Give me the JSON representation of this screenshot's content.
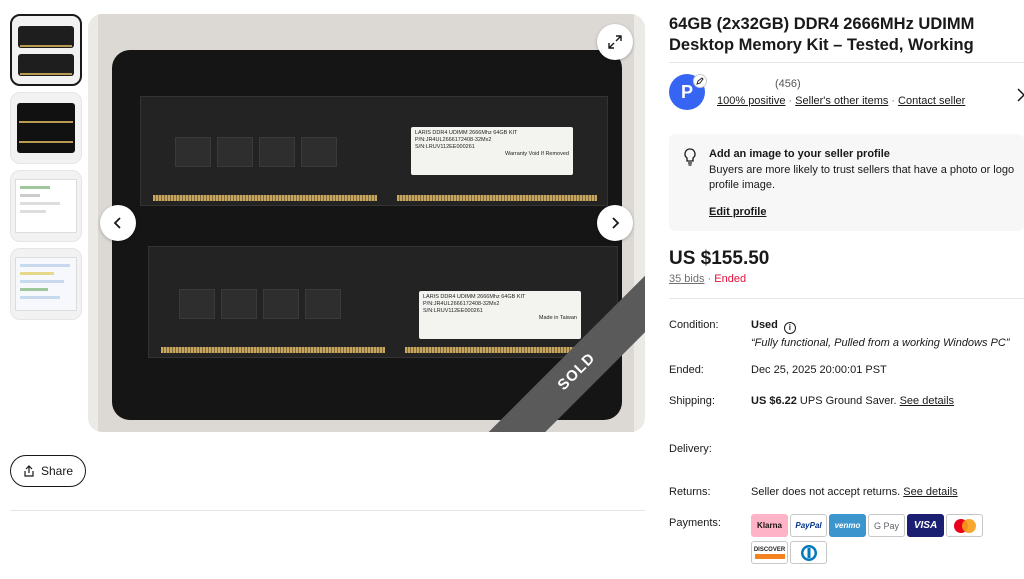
{
  "listing": {
    "title": "64GB (2x32GB) DDR4 2666MHz UDIMM Desktop Memory Kit – Tested, Working"
  },
  "gallery": {
    "sold_badge": "SOLD",
    "ram_label_line1": "LARIS DDR4 UDIMM 2666Mhz 64GB KIT",
    "ram_label_line2": "P/N:JR4UL2666172408-32Mx2",
    "ram_label_line3": "S/N:LRUV112EE000261",
    "ram_label_made": "Made in Taiwan",
    "ram_label_warranty": "Warranty Void If Removed",
    "ram_brand": "LEVEN"
  },
  "share": {
    "label": "Share"
  },
  "seller": {
    "avatar_letter": "P",
    "feedback_count": "(456)",
    "positive": "100% positive",
    "other_items": "Seller's other items",
    "contact": "Contact seller"
  },
  "profile_prompt": {
    "title": "Add an image to your seller profile",
    "text": "Buyers are more likely to trust sellers that have a photo or logo profile image.",
    "link": "Edit profile"
  },
  "price": {
    "amount": "US $155.50",
    "bids": "35 bids",
    "sep": " · ",
    "status": "Ended"
  },
  "details": {
    "condition_label": "Condition:",
    "condition_value": "Used",
    "condition_note": "“Fully functional, Pulled from a working Windows PC”",
    "ended_label": "Ended:",
    "ended_value": "Dec 25, 2025 20:00:01 PST",
    "shipping_label": "Shipping:",
    "shipping_price": "US $6.22",
    "shipping_method": " UPS Ground Saver. ",
    "shipping_link": "See details",
    "delivery_label": "Delivery:",
    "returns_label": "Returns:",
    "returns_value": "Seller does not accept returns. ",
    "returns_link": "See details",
    "payments_label": "Payments:"
  },
  "payments": [
    "Klarna",
    "PayPal",
    "venmo",
    "G Pay",
    "VISA",
    "Mastercard",
    "DISCOVER",
    "Diners Club"
  ],
  "colors": {
    "accent_blue": "#3665f3",
    "ended_red": "#e0103a",
    "klarna_pink": "#ffb3c7",
    "paypal_blue": "#003087",
    "venmo_blue": "#3d95ce",
    "visa_blue": "#1a1f71",
    "discover_orange": "#f58220"
  }
}
